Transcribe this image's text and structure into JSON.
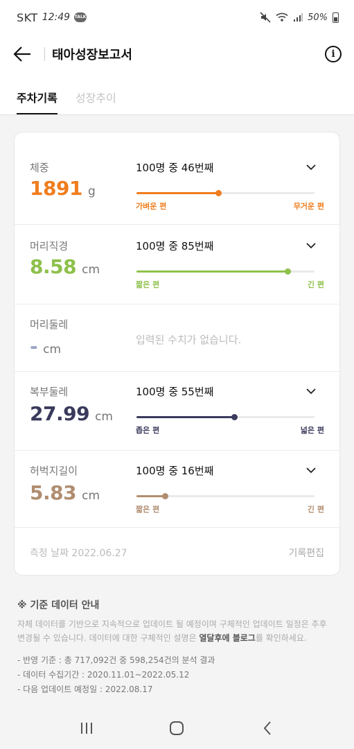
{
  "status_bar": {
    "carrier": "SKT",
    "time": "12:49",
    "talk_badge": "TALK",
    "battery": "50%"
  },
  "app_bar": {
    "title": "태아성장보고서",
    "info_icon": "i"
  },
  "tabs": [
    {
      "label": "주차기록",
      "active": true
    },
    {
      "label": "성장추이",
      "active": false
    }
  ],
  "measurements": [
    {
      "label": "체중",
      "value": "1891",
      "unit": "g",
      "rank": "100명 중 46번째",
      "percent": 46,
      "left_label": "가벼운 편",
      "right_label": "무거운 편",
      "color": "#f07d1e"
    },
    {
      "label": "머리직경",
      "value": "8.58",
      "unit": "cm",
      "rank": "100명 중 85번째",
      "percent": 85,
      "left_label": "짧은 편",
      "right_label": "긴 편",
      "color": "#8ec04a"
    },
    {
      "label": "머리둘레",
      "value": "-",
      "unit": "cm",
      "empty_message": "입력된 수치가 없습니다.",
      "color": "#9aa7c6"
    },
    {
      "label": "복부둘레",
      "value": "27.99",
      "unit": "cm",
      "rank": "100명 중 55번째",
      "percent": 55,
      "left_label": "좁은 편",
      "right_label": "넓은 편",
      "color": "#3a3a5c"
    },
    {
      "label": "허벅지길이",
      "value": "5.83",
      "unit": "cm",
      "rank": "100명 중 16번째",
      "percent": 16,
      "left_label": "짧은 편",
      "right_label": "긴 편",
      "color": "#b08d70"
    }
  ],
  "card_footer": {
    "date": "측정 날짜 2022.06.27",
    "edit_label": "기록편집"
  },
  "notice": {
    "title": "※ 기준 데이터 안내",
    "body_part1": "자체 데이터를 기반으로 지속적으로 업데이트 될 예정이며 구체적인 업데이트 일정은 추후 변경될 수 있습니다. 데이터에 대한 구체적인 설명은 ",
    "body_link": "열달후에 블로그",
    "body_part2": "를 확인하세요.",
    "items": [
      "- 반영 기준 : 총 717,092건 중 598,254건의 분석 결과",
      "- 데이터 수집기간 : 2020.11.01~2022.05.12",
      "- 다음 업데이트 예정일 : 2022.08.17"
    ]
  }
}
